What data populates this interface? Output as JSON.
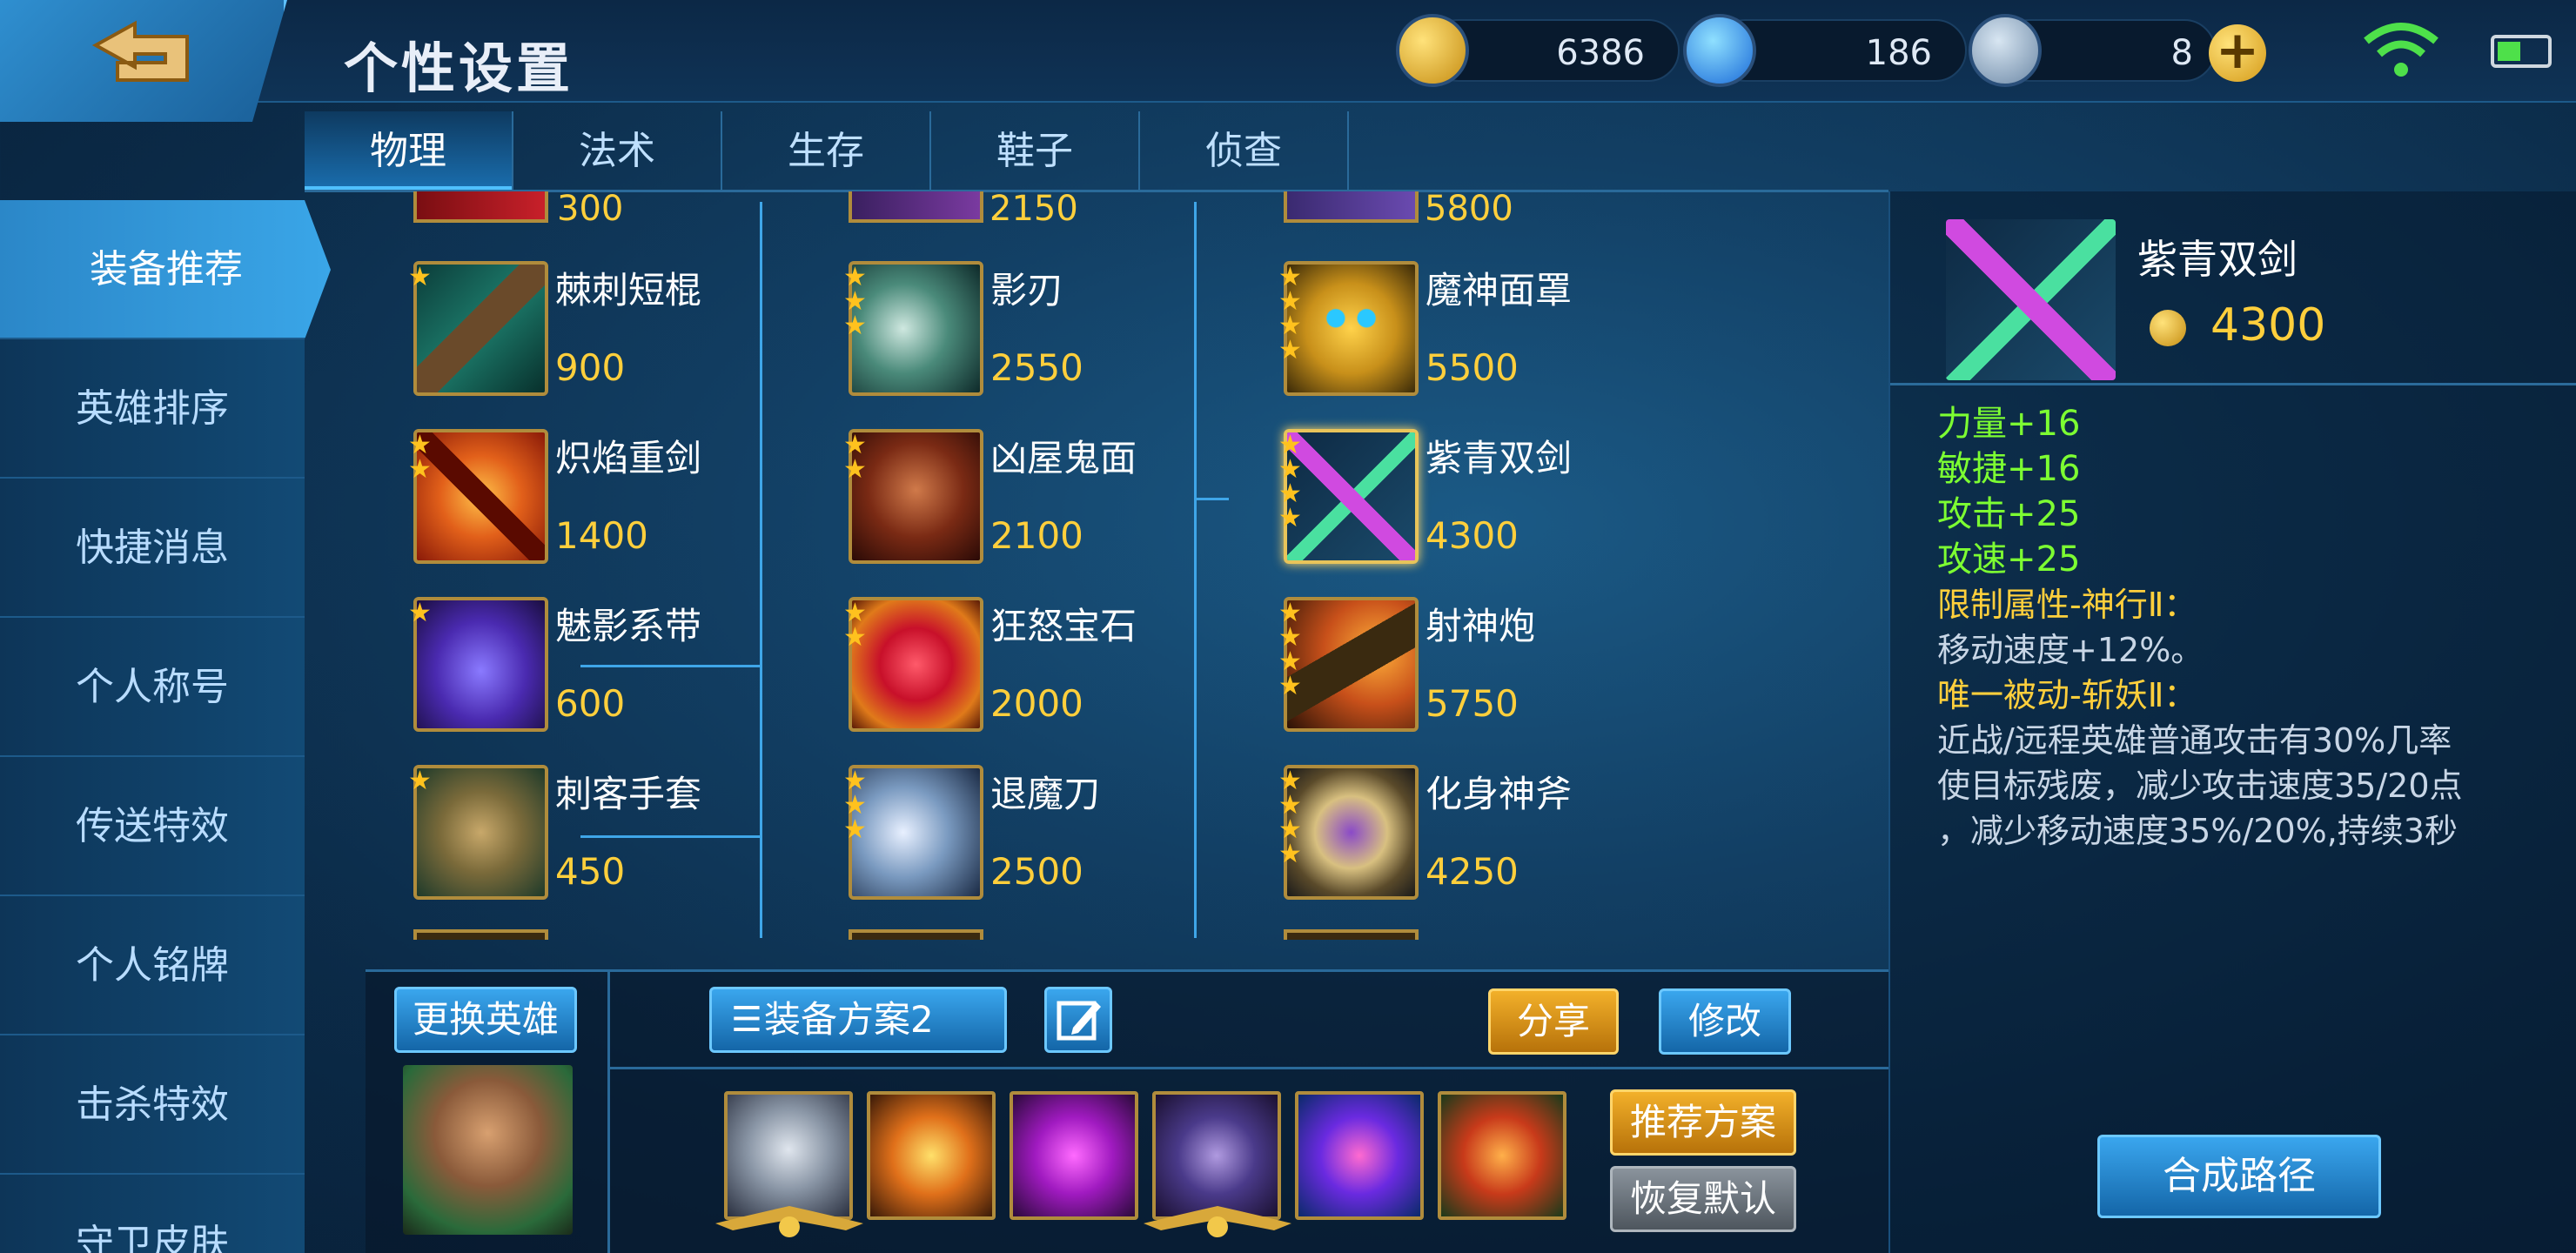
{
  "header": {
    "title": "个性设置",
    "gold": "6386",
    "diamond": "186",
    "voucher": "8"
  },
  "tabs": [
    "物理",
    "法术",
    "生存",
    "鞋子",
    "侦查"
  ],
  "sidebar": [
    "装备推荐",
    "英雄排序",
    "快捷消息",
    "个人称号",
    "传送特效",
    "个人铭牌",
    "击杀特效",
    "守卫皮肤"
  ],
  "columns": [
    {
      "top_price": "300",
      "items": [
        {
          "name": "棘刺短棍",
          "price": "900",
          "stars": 1
        },
        {
          "name": "炽焰重剑",
          "price": "1400",
          "stars": 2
        },
        {
          "name": "魅影系带",
          "price": "600",
          "stars": 1
        },
        {
          "name": "刺客手套",
          "price": "450",
          "stars": 1
        }
      ]
    },
    {
      "top_price": "2150",
      "items": [
        {
          "name": "影刃",
          "price": "2550",
          "stars": 3
        },
        {
          "name": "凶屋鬼面",
          "price": "2100",
          "stars": 2
        },
        {
          "name": "狂怒宝石",
          "price": "2000",
          "stars": 2
        },
        {
          "name": "退魔刀",
          "price": "2500",
          "stars": 3
        }
      ]
    },
    {
      "top_price": "5800",
      "items": [
        {
          "name": "魔神面罩",
          "price": "5500",
          "stars": 4
        },
        {
          "name": "紫青双剑",
          "price": "4300",
          "stars": 4
        },
        {
          "name": "射神炮",
          "price": "5750",
          "stars": 4
        },
        {
          "name": "化身神斧",
          "price": "4250",
          "stars": 4
        }
      ]
    }
  ],
  "detail": {
    "name": "紫青双剑",
    "price": "4300",
    "stats": [
      "力量+16",
      "敏捷+16",
      "攻击+25",
      "攻速+25"
    ],
    "limit_title": "限制属性-神行Ⅱ：",
    "limit_desc": "移动速度+12%。",
    "passive_title": "唯一被动-斩妖Ⅱ：",
    "passive_desc": [
      "近战/远程英雄普通攻击有30%几率",
      "使目标残废，减少攻击速度35/20点",
      "，减少移动速度35%/20%,持续3秒"
    ],
    "compose_button": "合成路径"
  },
  "bottom": {
    "change_hero": "更换英雄",
    "plan": "装备方案2",
    "share": "分享",
    "modify": "修改",
    "recommend": "推荐方案",
    "restore": "恢复默认"
  },
  "colors": {
    "gold": "#ffcf3c",
    "stat_green": "#7dff32",
    "accent_blue": "#3aa6ee"
  }
}
